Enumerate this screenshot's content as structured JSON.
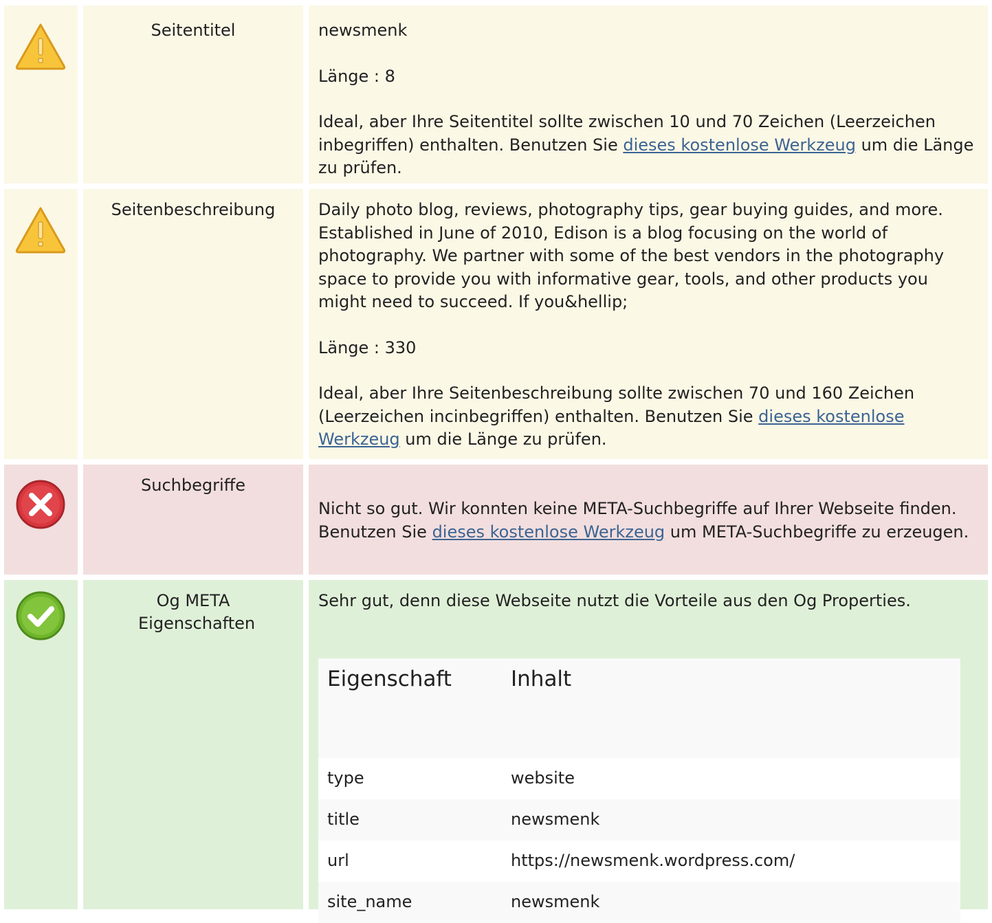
{
  "colors": {
    "warning_bg": "#fcf8e6",
    "error_bg": "#f2dede",
    "success_bg": "#dff0d8",
    "link": "#3b6493"
  },
  "rows": [
    {
      "status": "warning",
      "icon": "warning-icon",
      "label": "Seitentitel",
      "value": "newsmenk",
      "length": "Länge : 8",
      "advice_before": "Ideal, aber Ihre Seitentitel sollte zwischen 10 und 70 Zeichen (Leerzeichen inbegriffen) enthalten. Benutzen Sie ",
      "link_text": "dieses kostenlose Werkzeug",
      "advice_after": " um die Länge zu prüfen."
    },
    {
      "status": "warning",
      "icon": "warning-icon",
      "label": "Seitenbeschreibung",
      "value": "Daily photo blog, reviews, photography tips, gear buying guides, and more. Established in June of 2010, Edison is a blog focusing on the world of photography. We partner with some of the best vendors in the photography space to provide you with informative gear, tools, and other products you might need to succeed. If you&hellip;",
      "length": "Länge : 330",
      "advice_before": "Ideal, aber Ihre Seitenbeschreibung sollte zwischen 70 und 160 Zeichen (Leerzeichen incinbegriffen) enthalten. Benutzen Sie ",
      "link_text": "dieses kostenlose Werkzeug",
      "advice_after": " um die Länge zu prüfen."
    },
    {
      "status": "error",
      "icon": "error-x-icon",
      "label": "Suchbegriffe",
      "advice_before": "Nicht so gut. Wir konnten keine META-Suchbegriffe auf Ihrer Webseite finden. Benutzen Sie ",
      "link_text": "dieses kostenlose Werkzeug",
      "advice_after": " um META-Suchbegriffe zu erzeugen."
    },
    {
      "status": "success",
      "icon": "check-icon",
      "label": "Og META Eigenschaften",
      "text": "Sehr gut, denn diese Webseite nutzt die Vorteile aus den Og Properties.",
      "table": {
        "headers": [
          "Eigenschaft",
          "Inhalt"
        ],
        "rows": [
          [
            "type",
            "website"
          ],
          [
            "title",
            "newsmenk"
          ],
          [
            "url",
            "https://newsmenk.wordpress.com/"
          ],
          [
            "site_name",
            "newsmenk"
          ]
        ]
      }
    }
  ]
}
